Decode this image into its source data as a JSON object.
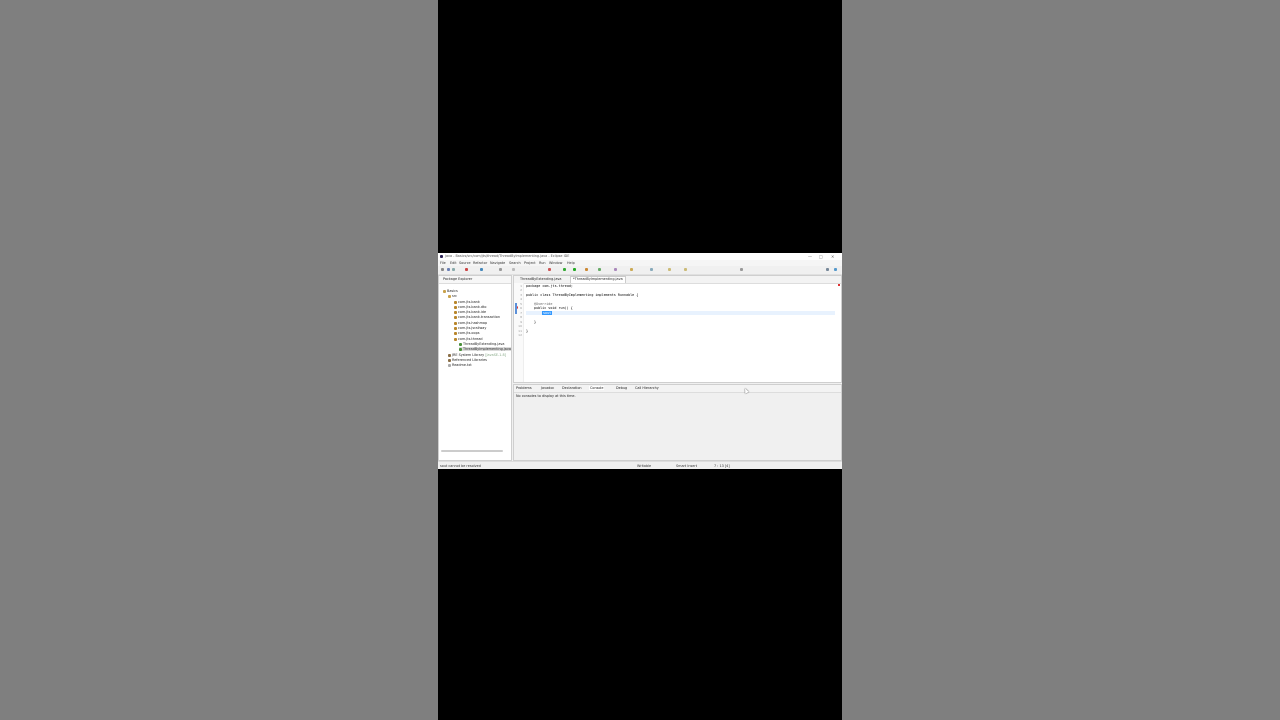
{
  "window": {
    "title": "java - Basics/src/com/jts/thread/ThreadByImplementing.java - Eclipse IDE",
    "controls": [
      "—",
      "□",
      "✕"
    ]
  },
  "menu": [
    "File",
    "Edit",
    "Source",
    "Refactor",
    "Navigate",
    "Search",
    "Project",
    "Run",
    "Window",
    "Help"
  ],
  "package_explorer": {
    "title": "Package Explorer",
    "project": "Basics",
    "src": "src",
    "packages": [
      "com.jts.bank",
      "com.jts.bank.dto",
      "com.jts.bank.ide",
      "com.jts.bank.transaction",
      "com.jts.hashmap",
      "com.jts.jsrailway",
      "com.jts.oops",
      "com.jts.thread"
    ],
    "files": [
      "ThreadByExtending.java",
      "ThreadByImplementing.java"
    ],
    "jre": "JRE System Library",
    "jre_suffix": "[JavaSE-1.8]",
    "libs": "Referenced Libraries",
    "readme": "Readme.txt"
  },
  "editor": {
    "tabs": [
      "ThreadByExtending.java",
      "*ThreadByImplementing.java"
    ],
    "line_numbers": [
      "1",
      "2",
      "3",
      "4",
      "5",
      "6",
      "7",
      "8",
      "9",
      "10",
      "11",
      "12"
    ],
    "lines": {
      "l1": "package com.jts.thread;",
      "l3": "public class ThreadByImplementing implements Runnable {",
      "l5": "@Override",
      "l6": "public void run() {",
      "l7": "sout",
      "l9": "}",
      "l11": "}"
    }
  },
  "bottom_panel": {
    "tabs": [
      "Problems",
      "Javadoc",
      "Declaration",
      "Console",
      "Debug",
      "Call Hierarchy"
    ],
    "console_message": "No consoles to display at this time."
  },
  "status": {
    "error": "sout cannot be resolved",
    "writable": "Writable",
    "insert_mode": "Smart Insert",
    "position": "7 : 13 [4]"
  }
}
